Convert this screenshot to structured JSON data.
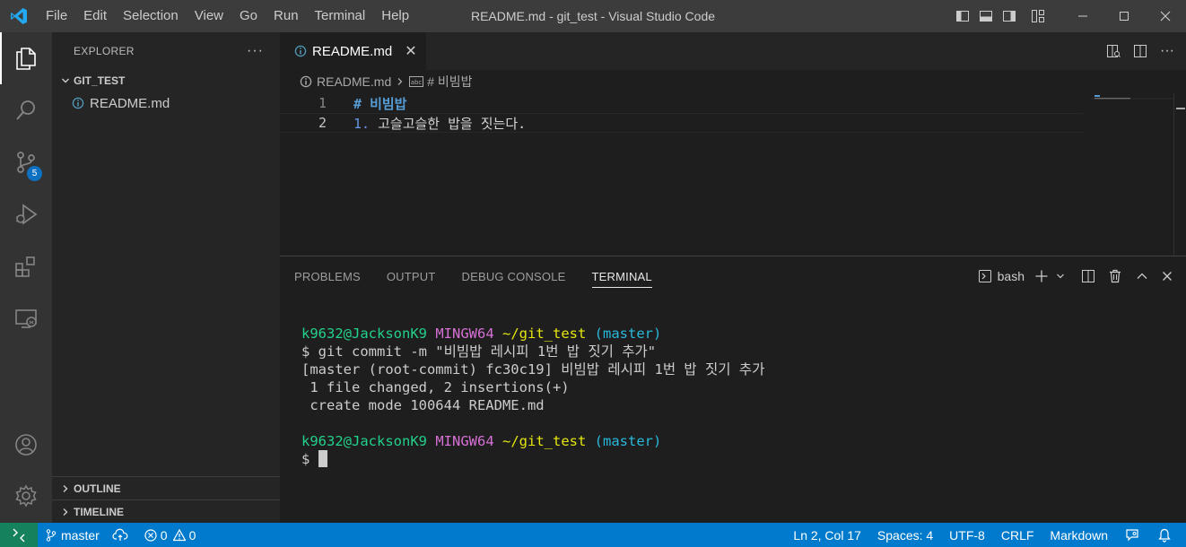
{
  "window": {
    "title": "README.md - git_test - Visual Studio Code"
  },
  "menu": [
    "File",
    "Edit",
    "Selection",
    "View",
    "Go",
    "Run",
    "Terminal",
    "Help"
  ],
  "activity_bar": {
    "scm_badge": "5"
  },
  "explorer": {
    "title": "EXPLORER",
    "more": "···",
    "folder": "GIT_TEST",
    "files": [
      "README.md"
    ],
    "outline": "OUTLINE",
    "timeline": "TIMELINE"
  },
  "editor": {
    "tab": {
      "label": "README.md",
      "close": "✕"
    },
    "breadcrumb": {
      "file": "README.md",
      "symbol": "# 비빔밥"
    },
    "lines": [
      {
        "number": "1",
        "marker": "# ",
        "text": "비빔밥"
      },
      {
        "number": "2",
        "marker": "1. ",
        "text": "고슬고슬한 밥을 짓는다."
      }
    ]
  },
  "panel": {
    "tabs": [
      "PROBLEMS",
      "OUTPUT",
      "DEBUG CONSOLE",
      "TERMINAL"
    ],
    "active_tab": "TERMINAL",
    "shell": "bash",
    "terminal": {
      "prompt": {
        "user": "k9632@JacksonK9",
        "system": "MINGW64",
        "path": "~/git_test",
        "branch": "(master)"
      },
      "command": "$ git commit -m \"비빔밥 레시피 1번 밥 짓기 추가\"",
      "output": [
        "[master (root-commit) fc30c19] 비빔밥 레시피 1번 밥 짓기 추가",
        " 1 file changed, 2 insertions(+)",
        " create mode 100644 README.md"
      ],
      "final_prompt": "$ "
    }
  },
  "status_bar": {
    "branch": "master",
    "errors": "0",
    "warnings": "0",
    "position": "Ln 2, Col 17",
    "spaces": "Spaces: 4",
    "encoding": "UTF-8",
    "eol": "CRLF",
    "language": "Markdown"
  },
  "colors": {
    "status_bar": "#007acc",
    "remote": "#16825d",
    "activity_bar": "#333333",
    "sidebar": "#252526",
    "editor": "#1e1e1e"
  }
}
